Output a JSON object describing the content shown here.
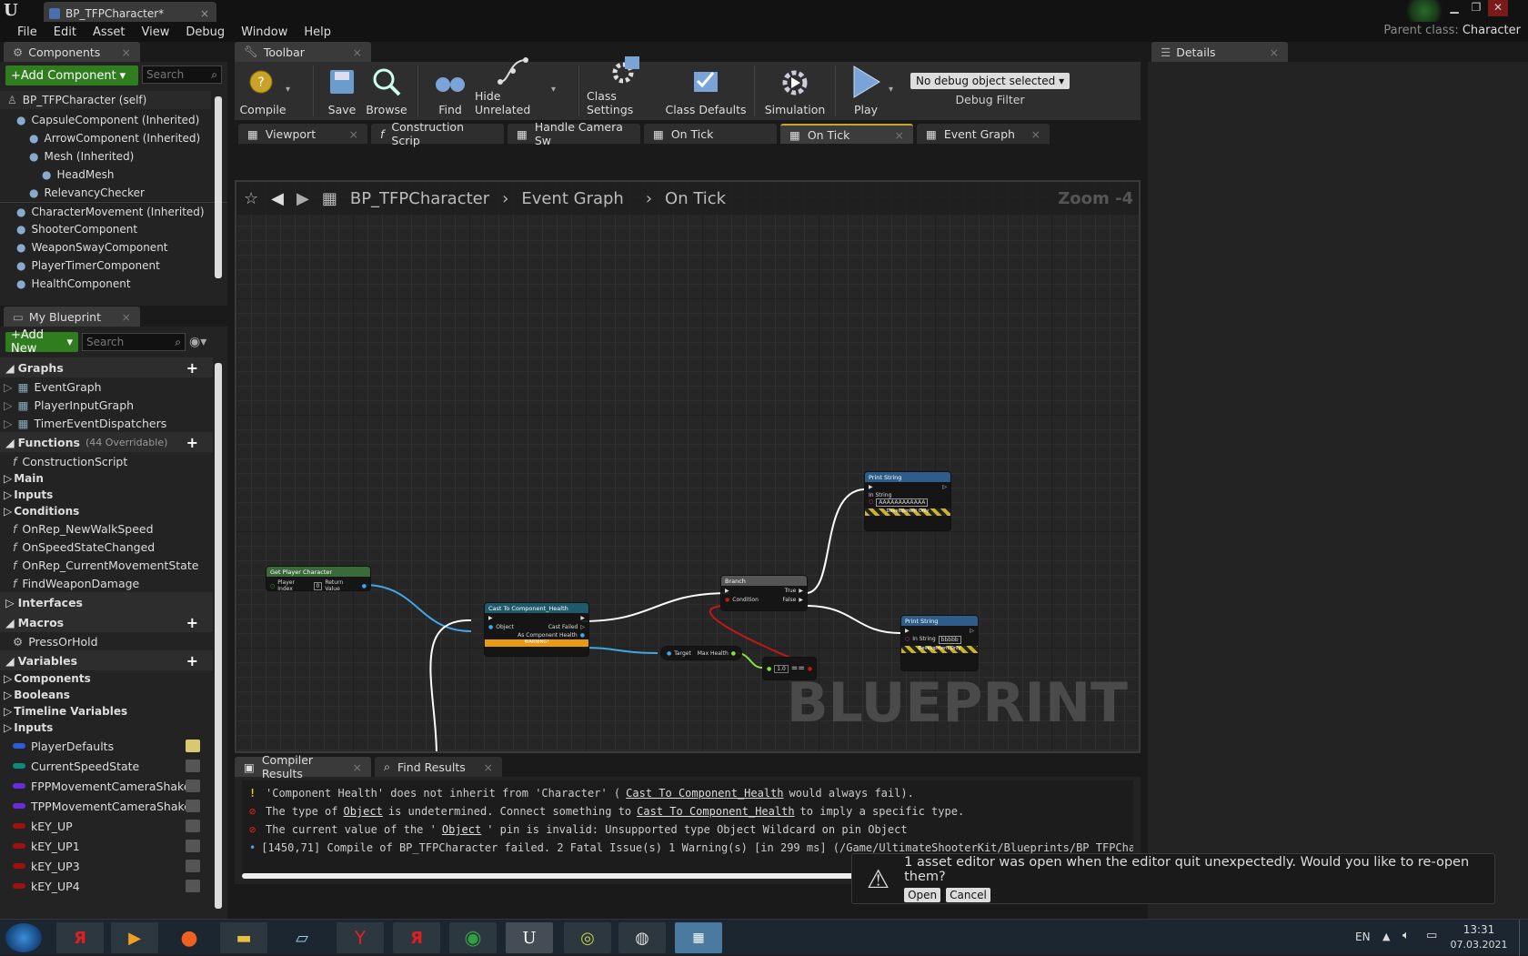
{
  "window": {
    "tab_title": "BP_TFPCharacter*",
    "tab_close": "×"
  },
  "menu": [
    "File",
    "Edit",
    "Asset",
    "View",
    "Debug",
    "Window",
    "Help"
  ],
  "parent_class": {
    "label": "Parent class:",
    "value": "Character"
  },
  "components_panel": {
    "title": "Components",
    "add_button": "+Add Component",
    "search_placeholder": "Search",
    "self": "BP_TFPCharacter (self)",
    "items": [
      {
        "label": "CapsuleComponent (Inherited)",
        "indent": 1
      },
      {
        "label": "ArrowComponent (Inherited)",
        "indent": 2
      },
      {
        "label": "Mesh (Inherited)",
        "indent": 2
      },
      {
        "label": "HeadMesh",
        "indent": 3
      },
      {
        "label": "RelevancyChecker",
        "indent": 2
      },
      {
        "label": "CharacterMovement (Inherited)",
        "indent": 1
      },
      {
        "label": "ShooterComponent",
        "indent": 1
      },
      {
        "label": "WeaponSwayComponent",
        "indent": 1
      },
      {
        "label": "PlayerTimerComponent",
        "indent": 1
      },
      {
        "label": "HealthComponent",
        "indent": 1
      }
    ]
  },
  "my_blueprint": {
    "title": "My Blueprint",
    "add_button": "+Add New",
    "search_placeholder": "Search",
    "graphs_title": "Graphs",
    "graphs": [
      "EventGraph",
      "PlayerInputGraph",
      "TimerEventDispatchers"
    ],
    "functions_title": "Functions",
    "functions_note": "(44 Overridable)",
    "functions_top": [
      "ConstructionScript"
    ],
    "function_categories": [
      "Main",
      "Inputs",
      "Conditions"
    ],
    "functions": [
      "OnRep_NewWalkSpeed",
      "OnSpeedStateChanged",
      "OnRep_CurrentMovementState",
      "FindWeaponDamage"
    ],
    "interfaces_title": "Interfaces",
    "macros_title": "Macros",
    "macros": [
      "PressOrHold"
    ],
    "variables_title": "Variables",
    "variable_categories": [
      "Components",
      "Booleans",
      "Timeline Variables",
      "Inputs"
    ],
    "variables": [
      {
        "name": "PlayerDefaults",
        "color": "#2a5dd8"
      },
      {
        "name": "CurrentSpeedState",
        "color": "#0e8a7a"
      },
      {
        "name": "FPPMovementCameraShakes",
        "color": "#6a2cd8"
      },
      {
        "name": "TPPMovementCameraShakes",
        "color": "#6a2cd8"
      },
      {
        "name": "kEY_UP",
        "color": "#a01010"
      },
      {
        "name": "kEY_UP1",
        "color": "#a01010"
      },
      {
        "name": "kEY_UP3",
        "color": "#a01010"
      },
      {
        "name": "kEY_UP4",
        "color": "#a01010"
      }
    ]
  },
  "toolbar": {
    "title": "Toolbar",
    "buttons": [
      "Compile",
      "Save",
      "Browse",
      "Find",
      "Hide Unrelated",
      "Class Settings",
      "Class Defaults",
      "Simulation",
      "Play"
    ],
    "debug_select": "No debug object selected",
    "debug_filter": "Debug Filter"
  },
  "details": {
    "title": "Details"
  },
  "graph_tabs": [
    "Viewport",
    "Construction Scrip",
    "Handle Camera Sw",
    "On Tick",
    "On Tick",
    "Event Graph"
  ],
  "breadcrumb": {
    "root": "BP_TFPCharacter",
    "mid": "Event Graph",
    "leaf": "On Tick"
  },
  "zoom": "Zoom -4",
  "watermark": "BLUEPRINT",
  "nodes": {
    "get_player": {
      "title": "Get Player Character",
      "pin_in": "Player Index",
      "pin_in_value": "0",
      "pin_out": "Return Value"
    },
    "cast": {
      "title": "Cast To Component_Health",
      "pin_obj": "Object",
      "pin_fail": "Cast Failed",
      "pin_out": "As Component Health",
      "warning": "WARNING!"
    },
    "max_health": {
      "pin_target": "Target",
      "pin_out": "Max Health"
    },
    "compare": {
      "symbol": "==",
      "value": "1.0"
    },
    "branch": {
      "title": "Branch",
      "pin_cond": "Condition",
      "pin_true": "True",
      "pin_false": "False"
    },
    "print1": {
      "title": "Print String",
      "pin": "In String",
      "value": "AAAAAAAAAAAA",
      "dev": "Development Only"
    },
    "print2": {
      "title": "Print String",
      "pin": "In String",
      "value": "bbbbb",
      "dev": "Development Only"
    }
  },
  "bottom_tabs": [
    "Compiler Results",
    "Find Results"
  ],
  "log": {
    "l1a": "'Component Health' does not inherit from 'Character' (",
    "l1b": "Cast To Component_Health",
    "l1c": "would always fail).",
    "l2a": "The type of",
    "l2b": "Object",
    "l2c": "is undetermined.  Connect something to",
    "l2d": "Cast To Component_Health",
    "l2e": "to imply a specific type.",
    "l3a": "The current value of the '",
    "l3b": "Object",
    "l3c": "' pin is invalid: Unsupported type Object Wildcard on pin Object",
    "l4": "[1450,71] Compile of BP_TFPCharacter failed. 2 Fatal Issue(s) 1 Warning(s) [in 299 ms] (/Game/UltimateShooterKit/Blueprints/BP_TFPCharact"
  },
  "notification": {
    "text": "1 asset editor was open when the editor quit unexpectedly. Would you like to re-open them?",
    "open": "Open",
    "cancel": "Cancel"
  },
  "tray": {
    "lang": "EN",
    "time": "13:31",
    "date": "07.03.2021"
  }
}
